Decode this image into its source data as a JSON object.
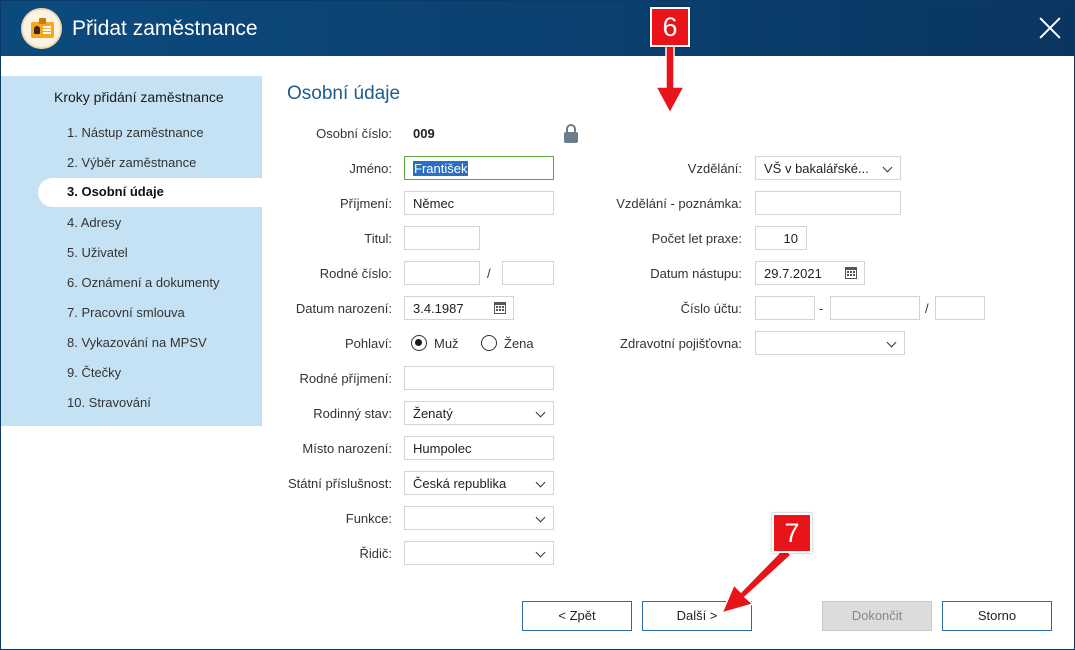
{
  "window": {
    "title": "Přidat zaměstnance"
  },
  "sidebar": {
    "title": "Kroky přidání zaměstnance",
    "steps": [
      "1. Nástup zaměstnance",
      "2. Výběr zaměstnance",
      "3. Osobní údaje",
      "4. Adresy",
      "5. Uživatel",
      "6. Oznámení a dokumenty",
      "7. Pracovní smlouva",
      "8. Vykazování na MPSV",
      "9. Čtečky",
      "10. Stravování"
    ],
    "active_step": "3. Osobní údaje"
  },
  "form": {
    "section_title": "Osobní údaje",
    "personal_number": {
      "label": "Osobní číslo:",
      "value": "009"
    },
    "first_name": {
      "label": "Jméno:",
      "value": "František"
    },
    "last_name": {
      "label": "Příjmení:",
      "value": "Němec"
    },
    "title": {
      "label": "Titul:",
      "value": ""
    },
    "birth_number": {
      "label": "Rodné číslo:",
      "separator": "/"
    },
    "birth_date": {
      "label": "Datum narození:",
      "value": "3.4.1987"
    },
    "gender": {
      "label": "Pohlaví:",
      "options": [
        "Muž",
        "Žena"
      ],
      "selected": "Muž"
    },
    "maiden_name": {
      "label": "Rodné příjmení:",
      "value": ""
    },
    "marital_status": {
      "label": "Rodinný stav:",
      "value": "Ženatý"
    },
    "birth_place": {
      "label": "Místo narození:",
      "value": "Humpolec"
    },
    "citizenship": {
      "label": "Státní příslušnost:",
      "value": "Česká republika"
    },
    "function": {
      "label": "Funkce:",
      "value": ""
    },
    "driver": {
      "label": "Řidič:",
      "value": ""
    },
    "education": {
      "label": "Vzdělání:",
      "value": "VŠ v bakalářské..."
    },
    "education_note": {
      "label": "Vzdělání - poznámka:",
      "value": ""
    },
    "years_practice": {
      "label": "Počet let praxe:",
      "value": "10"
    },
    "start_date": {
      "label": "Datum nástupu:",
      "value": "29.7.2021"
    },
    "account_number": {
      "label": "Číslo účtu:",
      "dash": "-",
      "slash": "/"
    },
    "health_insurance": {
      "label": "Zdravotní pojišťovna:",
      "value": ""
    }
  },
  "buttons": {
    "back": "< Zpět",
    "next": "Další >",
    "finish": "Dokončit",
    "cancel": "Storno"
  },
  "annotations": {
    "badge_6": "6",
    "badge_7": "7",
    "color": "#e8141a"
  }
}
